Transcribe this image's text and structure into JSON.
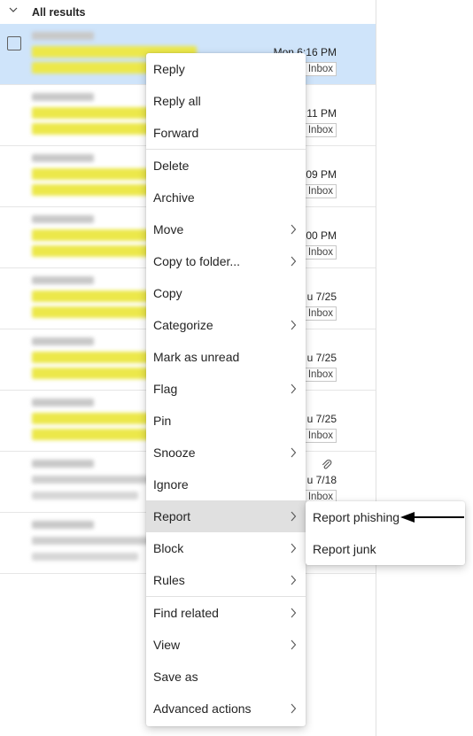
{
  "list": {
    "group_header": "All results",
    "rows": [
      {
        "time": "Mon 6:16 PM",
        "tag": "Inbox",
        "selected": true,
        "style": "highlight"
      },
      {
        "time": ":11 PM",
        "tag": "Inbox",
        "style": "highlight"
      },
      {
        "time": ":09 PM",
        "tag": "Inbox",
        "style": "highlight"
      },
      {
        "time": ":00 PM",
        "tag": "Inbox",
        "style": "highlight"
      },
      {
        "time": "u 7/25",
        "tag": "Inbox",
        "style": "highlight"
      },
      {
        "time": "u 7/25",
        "tag": "Inbox",
        "style": "highlight"
      },
      {
        "time": "u 7/25",
        "tag": "Inbox",
        "style": "highlight"
      },
      {
        "time": "u 7/18",
        "tag": "Inbox",
        "style": "gray",
        "attachment_icon": "paperclip-icon"
      },
      {
        "time": "",
        "tag": "",
        "style": "gray"
      }
    ]
  },
  "context_menu": {
    "items": [
      {
        "label": "Reply",
        "submenu": false
      },
      {
        "label": "Reply all",
        "submenu": false
      },
      {
        "label": "Forward",
        "submenu": false
      },
      {
        "label": "Delete",
        "submenu": false
      },
      {
        "label": "Archive",
        "submenu": false
      },
      {
        "label": "Move",
        "submenu": true
      },
      {
        "label": "Copy to folder...",
        "submenu": true
      },
      {
        "label": "Copy",
        "submenu": false
      },
      {
        "label": "Categorize",
        "submenu": true
      },
      {
        "label": "Mark as unread",
        "submenu": false
      },
      {
        "label": "Flag",
        "submenu": true
      },
      {
        "label": "Pin",
        "submenu": false
      },
      {
        "label": "Snooze",
        "submenu": true
      },
      {
        "label": "Ignore",
        "submenu": false
      },
      {
        "label": "Report",
        "submenu": true,
        "active": true
      },
      {
        "label": "Block",
        "submenu": true
      },
      {
        "label": "Rules",
        "submenu": true
      },
      {
        "label": "Find related",
        "submenu": true
      },
      {
        "label": "View",
        "submenu": true
      },
      {
        "label": "Save as",
        "submenu": false
      },
      {
        "label": "Advanced actions",
        "submenu": true
      }
    ]
  },
  "report_submenu": {
    "items": [
      {
        "label": "Report phishing"
      },
      {
        "label": "Report junk"
      }
    ]
  },
  "colors": {
    "selected_row": "#cfe4fa",
    "highlight": "#ece84a",
    "menu_active": "#e0e0e0"
  }
}
